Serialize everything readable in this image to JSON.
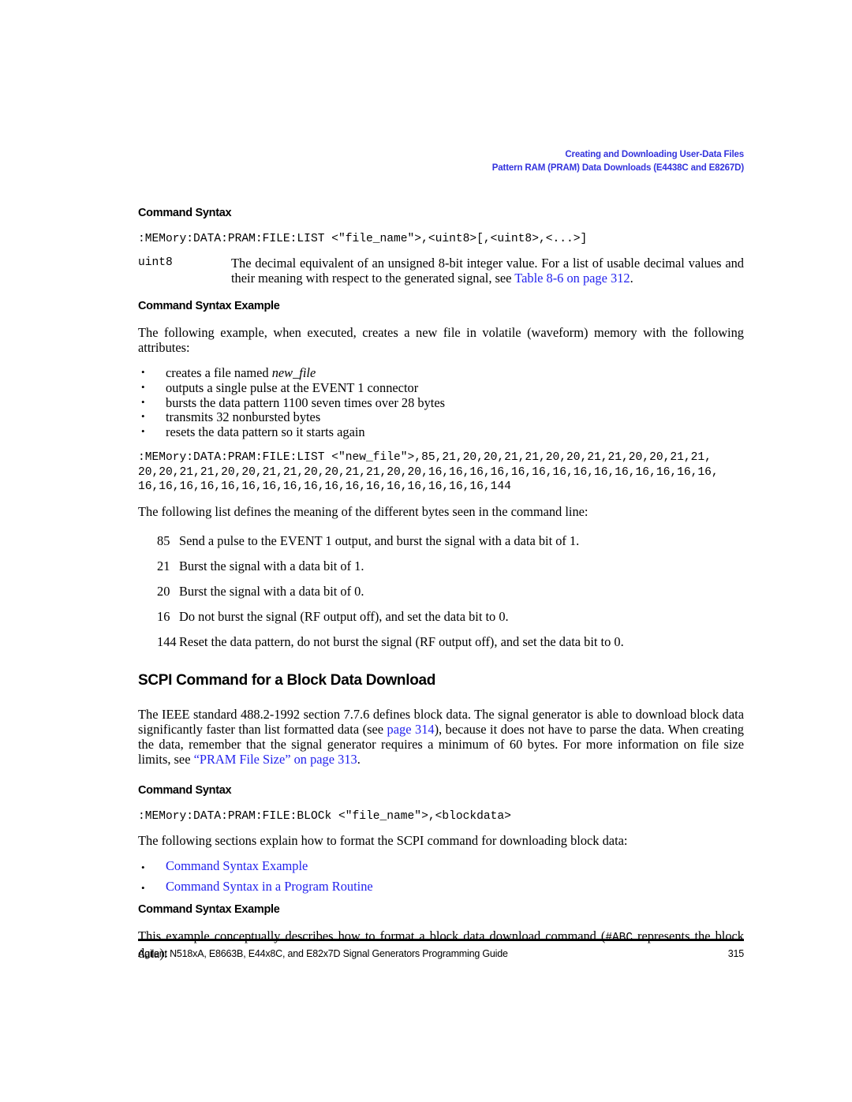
{
  "running_header": {
    "line1": "Creating and Downloading User-Data Files",
    "line2": "Pattern RAM (PRAM) Data Downloads (E4438C and E8267D)",
    "color": "#3333dd"
  },
  "link_color": "#2222ee",
  "section_list": {
    "heading_command_syntax_1": "Command Syntax",
    "syntax_line_1": ":MEMory:DATA:PRAM:FILE:LIST <\"file_name\">,<uint8>[,<uint8>,<...>]",
    "uint8_term": "uint8",
    "uint8_desc_pre": "The decimal equivalent of an unsigned 8-bit integer value. For a list of usable decimal values and their meaning with respect to the generated signal, see ",
    "uint8_desc_link": "Table 8-6 on page 312",
    "uint8_desc_post": ".",
    "heading_command_syntax_example_1": "Command Syntax Example",
    "intro_paragraph": "The following example, when executed, creates a new file in volatile (waveform) memory with the following attributes:",
    "attributes": [
      {
        "pre": "creates a file named ",
        "italic": "new_file",
        "post": ""
      },
      {
        "pre": "outputs a single pulse at the EVENT 1 connector",
        "italic": "",
        "post": ""
      },
      {
        "pre": "bursts the data pattern 1100 seven times over 28 bytes",
        "italic": "",
        "post": ""
      },
      {
        "pre": "transmits 32 nonbursted bytes",
        "italic": "",
        "post": ""
      },
      {
        "pre": "resets the data pattern so it starts again",
        "italic": "",
        "post": ""
      }
    ],
    "example_command_lines": [
      ":MEMory:DATA:PRAM:FILE:LIST <\"new_file\">,85,21,20,20,21,21,20,20,21,21,20,20,21,21,",
      "20,20,21,21,20,20,21,21,20,20,21,21,20,20,16,16,16,16,16,16,16,16,16,16,16,16,16,16,",
      "16,16,16,16,16,16,16,16,16,16,16,16,16,16,16,16,16,144"
    ],
    "byte_list_intro": "The following list defines the meaning of the different bytes seen in the command line:",
    "byte_meanings": [
      {
        "value": "85",
        "meaning": "Send a pulse to the EVENT 1 output, and burst the signal with a data bit of 1."
      },
      {
        "value": "21",
        "meaning": "Burst the signal with a data bit of 1."
      },
      {
        "value": "20",
        "meaning": "Burst the signal with a data bit of 0."
      },
      {
        "value": "16",
        "meaning": "Do not burst the signal (RF output off), and set the data bit to 0."
      },
      {
        "value": "144",
        "meaning": "Reset the data pattern, do not burst the signal (RF output off), and set the data bit to 0."
      }
    ]
  },
  "section_block": {
    "heading": "SCPI Command for a Block Data Download",
    "paragraph_part1": "The IEEE standard 488.2-1992 section 7.7.6 defines block data. The signal generator is able to download block data significantly faster than list formatted data (see ",
    "paragraph_link1": "page 314",
    "paragraph_part2": "), because it does not have to parse the data. When creating the data, remember that the signal generator requires a minimum of 60 bytes. For more information on file size limits, see ",
    "paragraph_link2": "“PRAM File Size” on page 313",
    "paragraph_part3": ".",
    "heading_command_syntax_2": "Command Syntax",
    "syntax_line_2": ":MEMory:DATA:PRAM:FILE:BLOCk <\"file_name\">,<blockdata>",
    "sections_intro": "The following sections explain how to format the SCPI command for downloading block data:",
    "section_links": [
      "Command Syntax Example",
      "Command Syntax in a Program Routine"
    ],
    "heading_command_syntax_example_2": "Command Syntax Example",
    "closing_paragraph_pre": "This example conceptually describes how to format a block data download command (",
    "closing_paragraph_mono": "#ABC",
    "closing_paragraph_post": " represents the block data):"
  },
  "footer": {
    "text": "Agilent N518xA, E8663B, E44x8C, and E82x7D Signal Generators Programming Guide",
    "page_number": "315"
  }
}
